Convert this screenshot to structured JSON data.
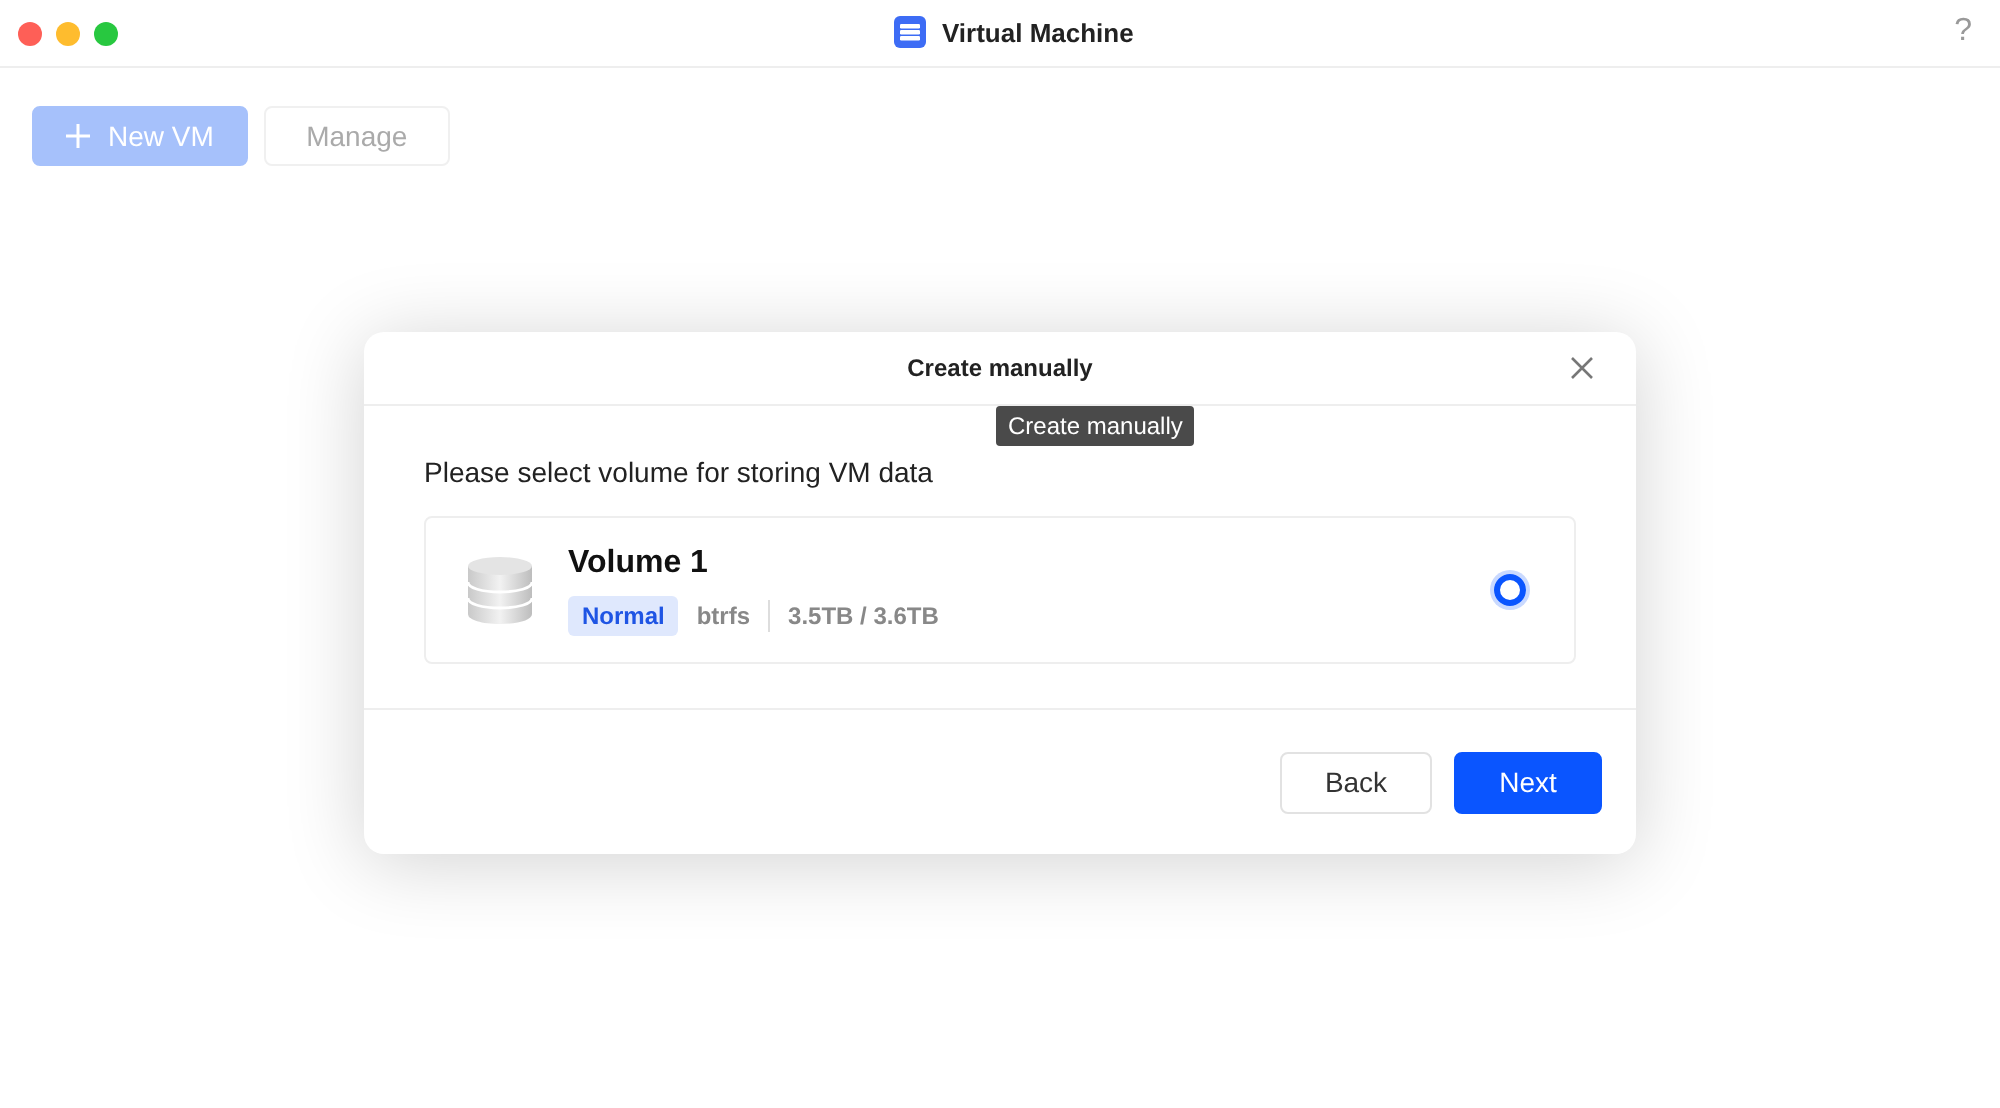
{
  "window": {
    "title": "Virtual Machine",
    "help": "?"
  },
  "toolbar": [
    {
      "label": "New VM",
      "kind": "primary",
      "disabled": true
    },
    {
      "label": "Manage",
      "kind": "secondary",
      "disabled": true
    }
  ],
  "dialog": {
    "title": "Create manually",
    "tooltip": "Create manually",
    "prompt": "Please select volume for storing VM data",
    "volumes": [
      {
        "name": "Volume 1",
        "status": "Normal",
        "filesystem": "btrfs",
        "usage": "3.5TB / 3.6TB",
        "selected": true
      }
    ],
    "buttons": [
      {
        "label": "Back",
        "primary": false
      },
      {
        "label": "Next",
        "primary": true
      }
    ]
  }
}
